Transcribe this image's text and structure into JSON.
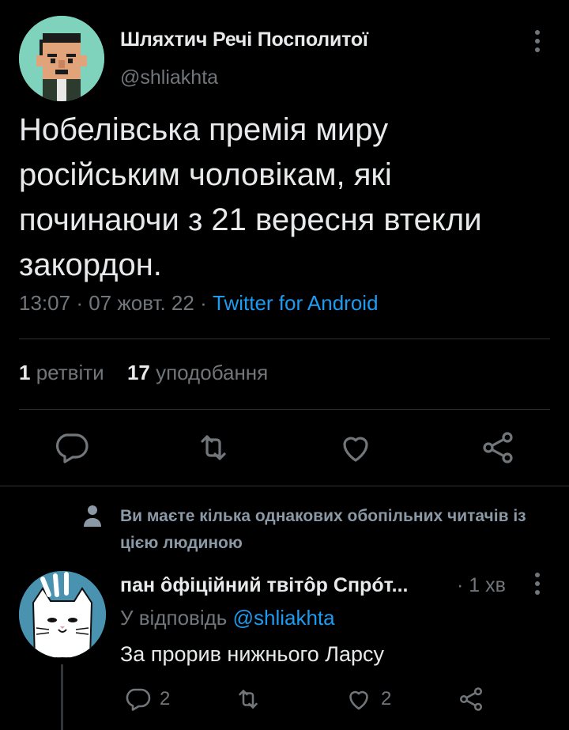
{
  "tweet": {
    "author_name": "Шляхтич Речі Посполитої",
    "author_handle": "@shliakhta",
    "avatar_icon": "pixel-art-man-avatar",
    "more_icon": "more-vertical-icon",
    "text_lines": [
      "Нобелівська премія миру",
      "російським чоловікам, які",
      "починаючи з 21 вересня втекли",
      "закордон."
    ],
    "time": "13:07",
    "date": "07 жовт. 22",
    "separator": "·",
    "source": "Twitter for Android",
    "retweets_count": "1",
    "retweets_label": "ретвіти",
    "likes_count": "17",
    "likes_label": "уподобання",
    "actions": [
      "reply-icon",
      "retweet-icon",
      "like-icon",
      "share-icon"
    ]
  },
  "notice": {
    "icon": "person-icon",
    "text": "Ви маєте кілька однакових обопільних читачів із цією людиною"
  },
  "reply": {
    "author_name": "пан ôфіційний твітôр Спрóт...",
    "time": "· 1 хв",
    "reply_to_label": "У відповідь",
    "reply_to_handle": "@shliakhta",
    "text": "За прорив нижнього Ларсу",
    "avatar_icon": "cat-cartoon-avatar",
    "reply_count": "2",
    "like_count": "2",
    "colors": {
      "accent": "#1d9bf0",
      "muted": "#71767b",
      "background": "#000000"
    }
  }
}
